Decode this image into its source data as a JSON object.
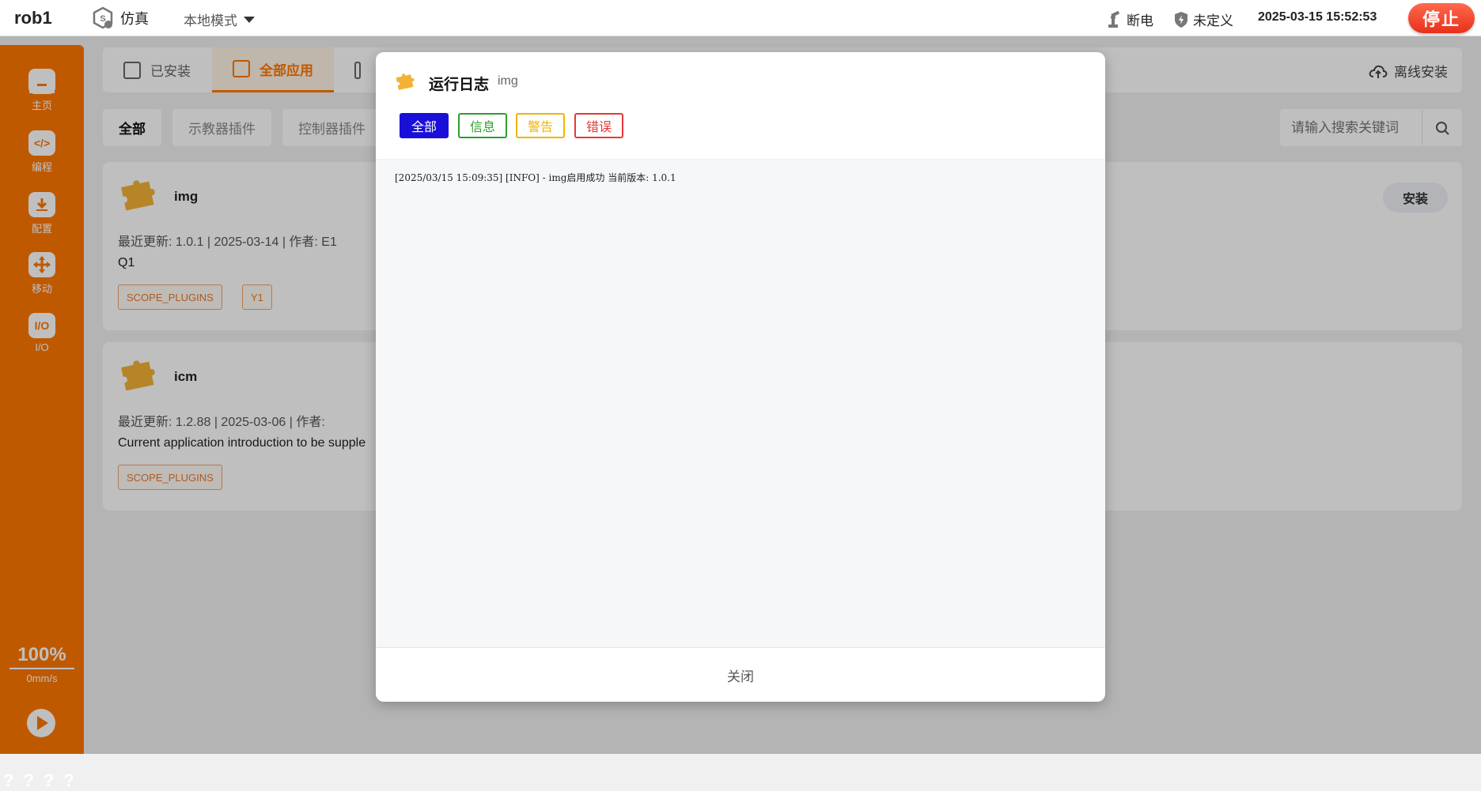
{
  "topbar": {
    "robot_name": "rob1",
    "sim_label": "仿真",
    "mode_label": "本地模式",
    "power_status": "断电",
    "safety_status": "未定义",
    "datetime": "2025-03-15 15:52:53",
    "stop_label": "停止"
  },
  "sidebar": {
    "items": [
      {
        "label": "主页",
        "icon": "home-icon"
      },
      {
        "label": "编程",
        "icon": "code-icon"
      },
      {
        "label": "配置",
        "icon": "config-icon"
      },
      {
        "label": "移动",
        "icon": "move-icon"
      },
      {
        "label": "I/O",
        "icon": "io-icon",
        "icon_text": "I/O"
      }
    ],
    "speed_percent": "100%",
    "speed_value": "0mm/s",
    "bottom_marks": [
      "?",
      "?",
      "?",
      "?"
    ]
  },
  "tabs": {
    "installed": "已安装",
    "all_apps": "全部应用",
    "offline_install": "离线安装"
  },
  "filters": {
    "all": "全部",
    "teach_plugin": "示教器插件",
    "controller_plugin": "控制器插件"
  },
  "search": {
    "placeholder": "请输入搜索关键词"
  },
  "cards": [
    {
      "name": "img",
      "meta": "最近更新: 1.0.1  |  2025-03-14  |  作者:  E1",
      "desc": "Q1",
      "tags": [
        "SCOPE_PLUGINS",
        "Y1"
      ],
      "action": "安装"
    },
    {
      "name": "icm",
      "meta": "最近更新: 1.2.88  |  2025-03-06  |  作者:",
      "desc": "Current application introduction to be supple",
      "tags": [
        "SCOPE_PLUGINS"
      ]
    }
  ],
  "modal": {
    "title": "运行日志",
    "subtitle": "img",
    "levels": {
      "all": "全部",
      "info": "信息",
      "warn": "警告",
      "error": "错误"
    },
    "colors": {
      "all": "#1a0fd8",
      "info": "#2e9e2e",
      "warn": "#f0b400",
      "error": "#e53935"
    },
    "log_lines": [
      "[2025/03/15 15:09:35] [INFO] - img启用成功 当前版本: 1.0.1"
    ],
    "close_label": "关闭"
  },
  "colors": {
    "brand": "#ff7700",
    "stop": "#e8301a"
  }
}
